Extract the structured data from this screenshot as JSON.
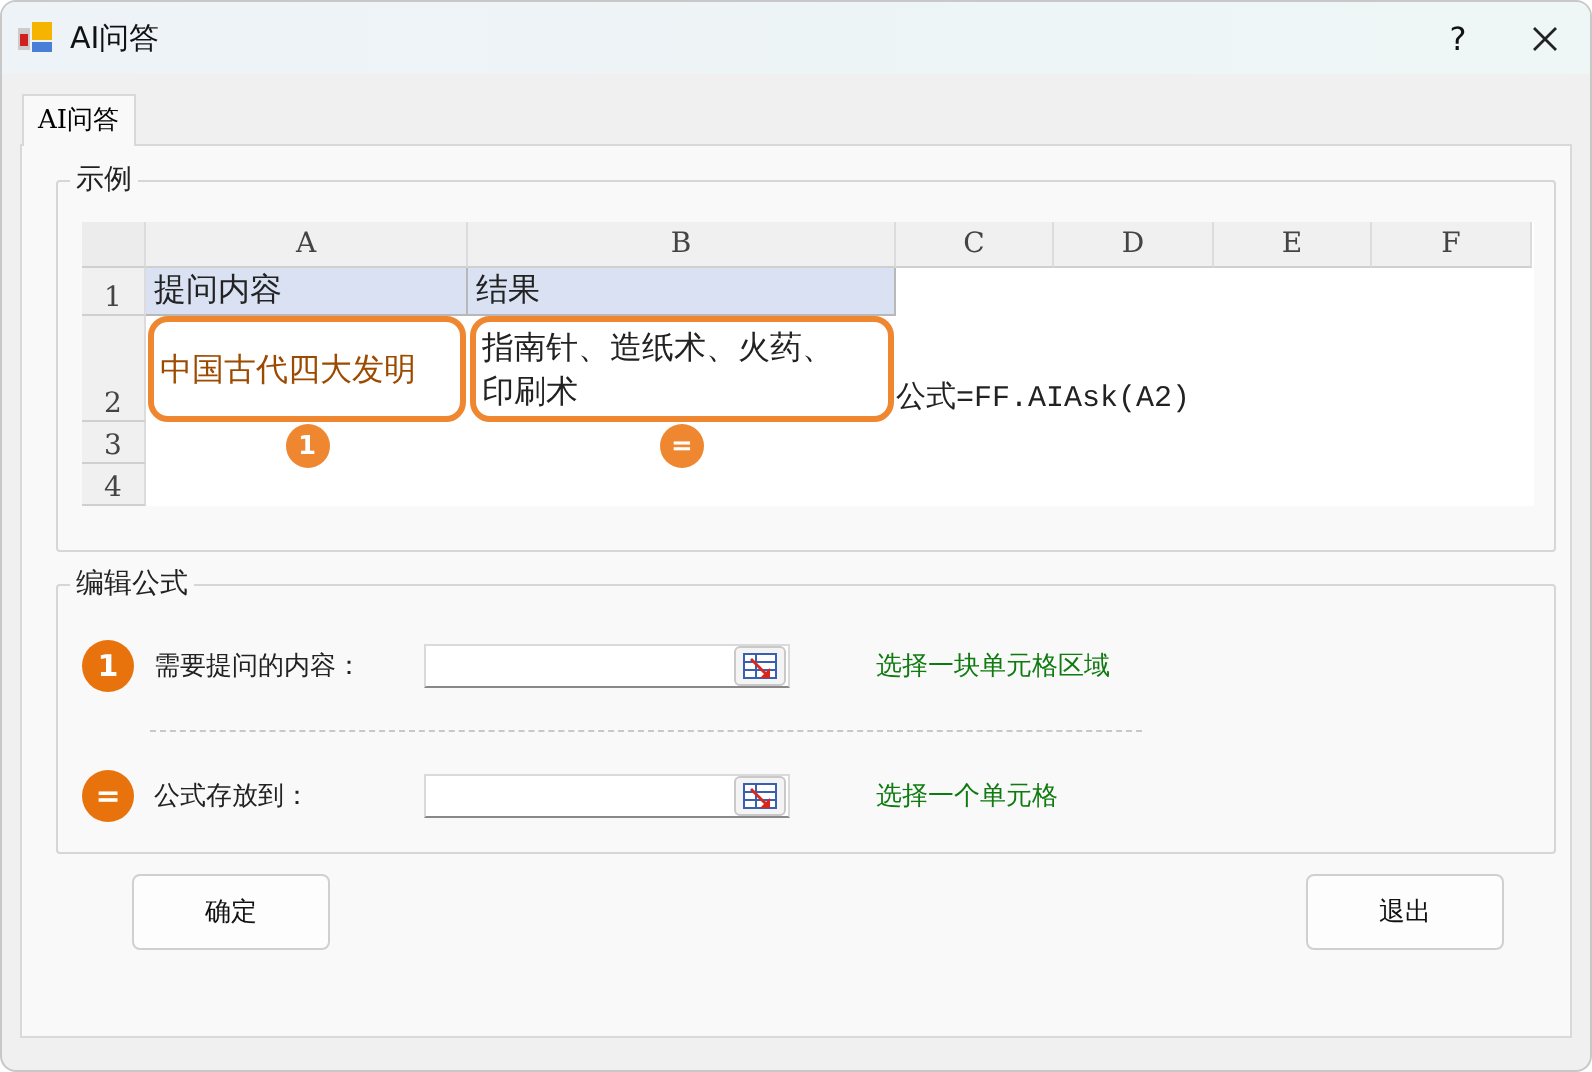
{
  "window": {
    "title": "AI问答",
    "help": "?"
  },
  "tabs": [
    {
      "label": "AI问答",
      "selected": true
    }
  ],
  "example": {
    "title": "示例",
    "sheet": {
      "columns": [
        "A",
        "B",
        "C",
        "D",
        "E",
        "F"
      ],
      "rows": [
        {
          "number": "1",
          "kind": "title",
          "cells": [
            "提问内容",
            "结果"
          ]
        },
        {
          "number": "2",
          "kind": "example",
          "cells": [
            "中国古代四大发明",
            "指南针、造纸术、火药、印刷术"
          ],
          "note": "公式=FF.AIAsk(A2)"
        },
        {
          "number": "3",
          "kind": "markers",
          "cells": [
            "1",
            "="
          ]
        },
        {
          "number": "4",
          "kind": "blank"
        }
      ]
    }
  },
  "edit": {
    "title": "编辑公式",
    "fields": [
      {
        "marker": "1",
        "label": "需要提问的内容：",
        "hint": "选择一块单元格区域"
      },
      {
        "marker": "=",
        "label": "公式存放到：",
        "hint": "选择一个单元格"
      }
    ]
  },
  "buttons": [
    "确定",
    "退出"
  ]
}
